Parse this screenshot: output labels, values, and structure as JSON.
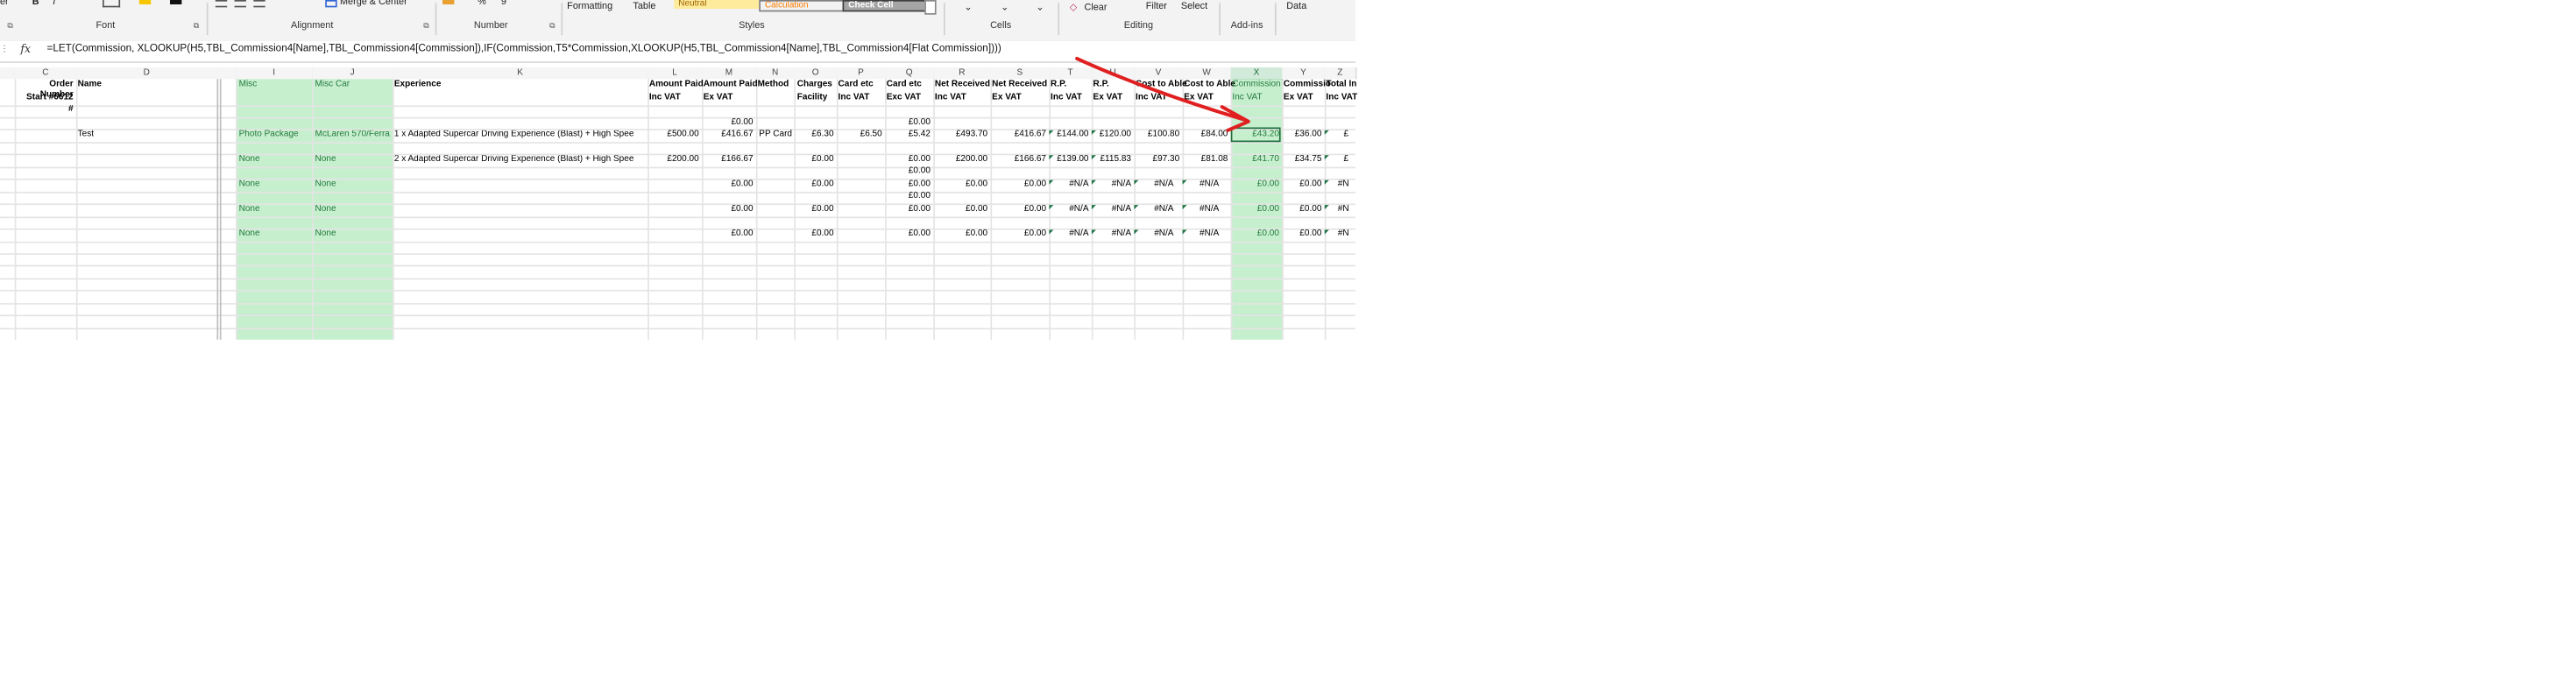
{
  "ribbon": {
    "font_group": "Font",
    "alignment_group": "Alignment",
    "number_group": "Number",
    "styles_group": "Styles",
    "cells_group": "Cells",
    "editing_group": "Editing",
    "addins_group": "Add-ins",
    "merge_center": "Merge & Center",
    "formatting": "Formatting",
    "table": "Table",
    "neutral": "Neutral",
    "calculation": "Calculation",
    "check_cell": "Check Cell",
    "clear": "Clear",
    "filter": "Filter",
    "select": "Select",
    "data": "Data",
    "bold": "B",
    "italic": "I",
    "left_edge": "er",
    "pct": "%",
    "comma": "9"
  },
  "formula_bar": {
    "fx": "fx",
    "formula": "=LET(Commission, XLOOKUP(H5,TBL_Commission4[Name],TBL_Commission4[Commission]),IF(Commission,T5*Commission,XLOOKUP(H5,TBL_Commission4[Name],TBL_Commission4[Flat Commission])))"
  },
  "columns": [
    "C",
    "D",
    "I",
    "J",
    "K",
    "L",
    "M",
    "N",
    "O",
    "P",
    "Q",
    "R",
    "S",
    "T",
    "U",
    "V",
    "W",
    "X",
    "Y",
    "Z"
  ],
  "headers": {
    "order_number": "Order Number",
    "start": "Start #6612",
    "hash": "#",
    "name": "Name",
    "misc": "Misc",
    "misc_car": "Misc Car",
    "experience": "Experience",
    "amount_paid_1": "Amount Paid",
    "inc_vat": "Inc VAT",
    "amount_paid_2": "Amount Paid",
    "ex_vat": "Ex VAT",
    "method": "Method",
    "charges": "Charges",
    "facility": "Facility",
    "card_etc": "Card etc",
    "card_etc_inc": "Inc VAT",
    "card_etc2": "Card etc",
    "card_etc_exc": "Exc VAT",
    "net_received_1": "Net Received",
    "net_inc": "Inc VAT",
    "net_received_2": "Net Received",
    "net_ex": "Ex VAT",
    "rp1": "R.P.",
    "rp1_sub": "Inc VAT",
    "rp2": "R.P.",
    "rp2_sub": "Ex VAT",
    "cost_able_1": "Cost to Able",
    "cost_able_1_sub": "Inc VAT",
    "cost_able_2": "Cost to Able",
    "cost_able_2_sub": "Ex VAT",
    "commission_1": "Commission",
    "commission_1_sub": "Inc VAT",
    "commission_2": "Commissio",
    "commission_2_sub": "Ex VAT",
    "total_1": "Total In",
    "total_1_sub": "Inc VAT"
  },
  "rows": {
    "m_blank": "£0.00",
    "q_blank": "£0.00",
    "r1": {
      "name": "Test",
      "misc": "Photo Package",
      "misc_car": "McLaren 570/Ferra",
      "experience": "1 x Adapted Supercar Driving Experience (Blast) + High Spee",
      "l": "£500.00",
      "m": "£416.67",
      "n": "PP Card",
      "o": "£6.30",
      "p": "£6.50",
      "q": "£5.42",
      "r": "£493.70",
      "s": "£416.67",
      "t": "£144.00",
      "u": "£120.00",
      "v": "£100.80",
      "w": "£84.00",
      "x": "£43.20",
      "y": "£36.00",
      "z": "£"
    },
    "r2": {
      "misc": "None",
      "misc_car": "None",
      "experience": "2 x Adapted Supercar Driving Experience (Blast) + High Spee",
      "l": "£200.00",
      "m": "£166.67",
      "o": "£0.00",
      "q": "£0.00",
      "r": "£200.00",
      "s": "£166.67",
      "t": "£139.00",
      "u": "£115.83",
      "v": "£97.30",
      "w": "£81.08",
      "x": "£41.70",
      "y": "£34.75",
      "z": "£",
      "q_extra": "£0.00"
    },
    "r3": {
      "misc": "None",
      "misc_car": "None",
      "m": "£0.00",
      "o": "£0.00",
      "q": "£0.00",
      "r": "£0.00",
      "s": "£0.00",
      "t": "#N/A",
      "u": "#N/A",
      "v": "#N/A",
      "w": "#N/A",
      "x": "£0.00",
      "y": "£0.00",
      "z": "#N",
      "q_extra": "£0.00"
    },
    "r4": {
      "misc": "None",
      "misc_car": "None",
      "m": "£0.00",
      "o": "£0.00",
      "q": "£0.00",
      "r": "£0.00",
      "s": "£0.00",
      "t": "#N/A",
      "u": "#N/A",
      "v": "#N/A",
      "w": "#N/A",
      "x": "£0.00",
      "y": "£0.00",
      "z": "#N"
    },
    "r5": {
      "misc": "None",
      "misc_car": "None",
      "m": "£0.00",
      "o": "£0.00",
      "q": "£0.00",
      "r": "£0.00",
      "s": "£0.00",
      "t": "#N/A",
      "u": "#N/A",
      "v": "#N/A",
      "w": "#N/A",
      "x": "£0.00",
      "y": "£0.00",
      "z": "#N"
    }
  },
  "colors": {
    "highlight_fill": "#c6efce",
    "highlight_text": "#267a3e",
    "arrow": "#e02020",
    "neutral_fill": "#ffeb9c",
    "calc_fill": "#f2f2f2",
    "check_fill": "#a5a5a5"
  }
}
